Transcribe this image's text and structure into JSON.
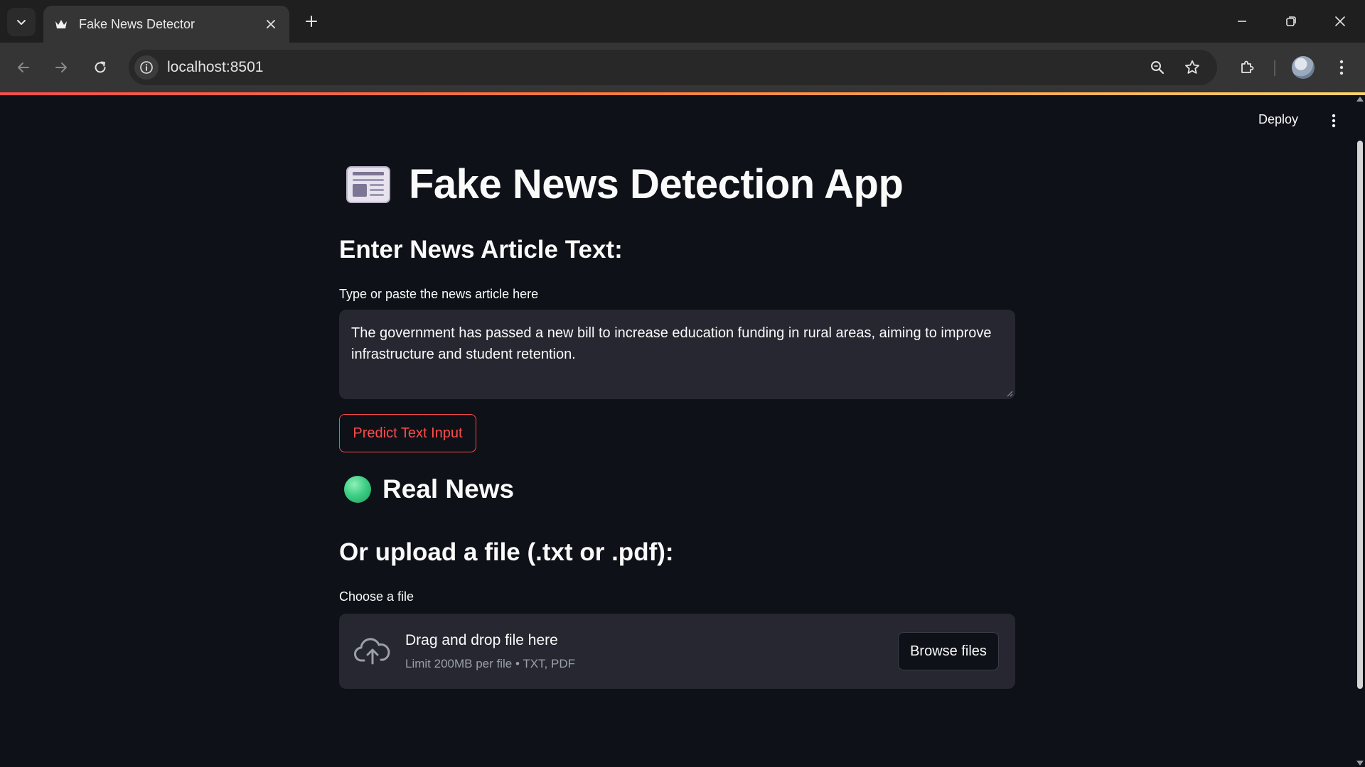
{
  "browser": {
    "tab_title": "Fake News Detector",
    "url": "localhost:8501"
  },
  "app": {
    "deploy_label": "Deploy",
    "title": "Fake News Detection App",
    "text_section_heading": "Enter News Article Text:",
    "textarea_label": "Type or paste the news article here",
    "textarea_value": "The government has passed a new bill to increase education funding in rural areas, aiming to improve infrastructure and student retention.",
    "predict_button_label": "Predict Text Input",
    "result_label": "Real News",
    "upload_heading": "Or upload a file (.txt or .pdf):",
    "file_label": "Choose a file",
    "dropzone_title": "Drag and drop file here",
    "dropzone_limit": "Limit 200MB per file • TXT, PDF",
    "browse_button_label": "Browse files"
  },
  "colors": {
    "background": "#0e1117",
    "input_background": "#262730",
    "accent_red": "#ff4b4b",
    "result_green": "#3fcf84"
  },
  "icons": [
    "chevron-down-icon",
    "crown-favicon-icon",
    "close-icon",
    "plus-icon",
    "minimize-icon",
    "restore-icon",
    "back-icon",
    "forward-icon",
    "reload-icon",
    "site-info-icon",
    "zoom-icon",
    "star-icon",
    "extensions-icon",
    "avatar",
    "menu-icon",
    "newspaper-icon",
    "green-circle-icon",
    "cloud-upload-icon"
  ]
}
